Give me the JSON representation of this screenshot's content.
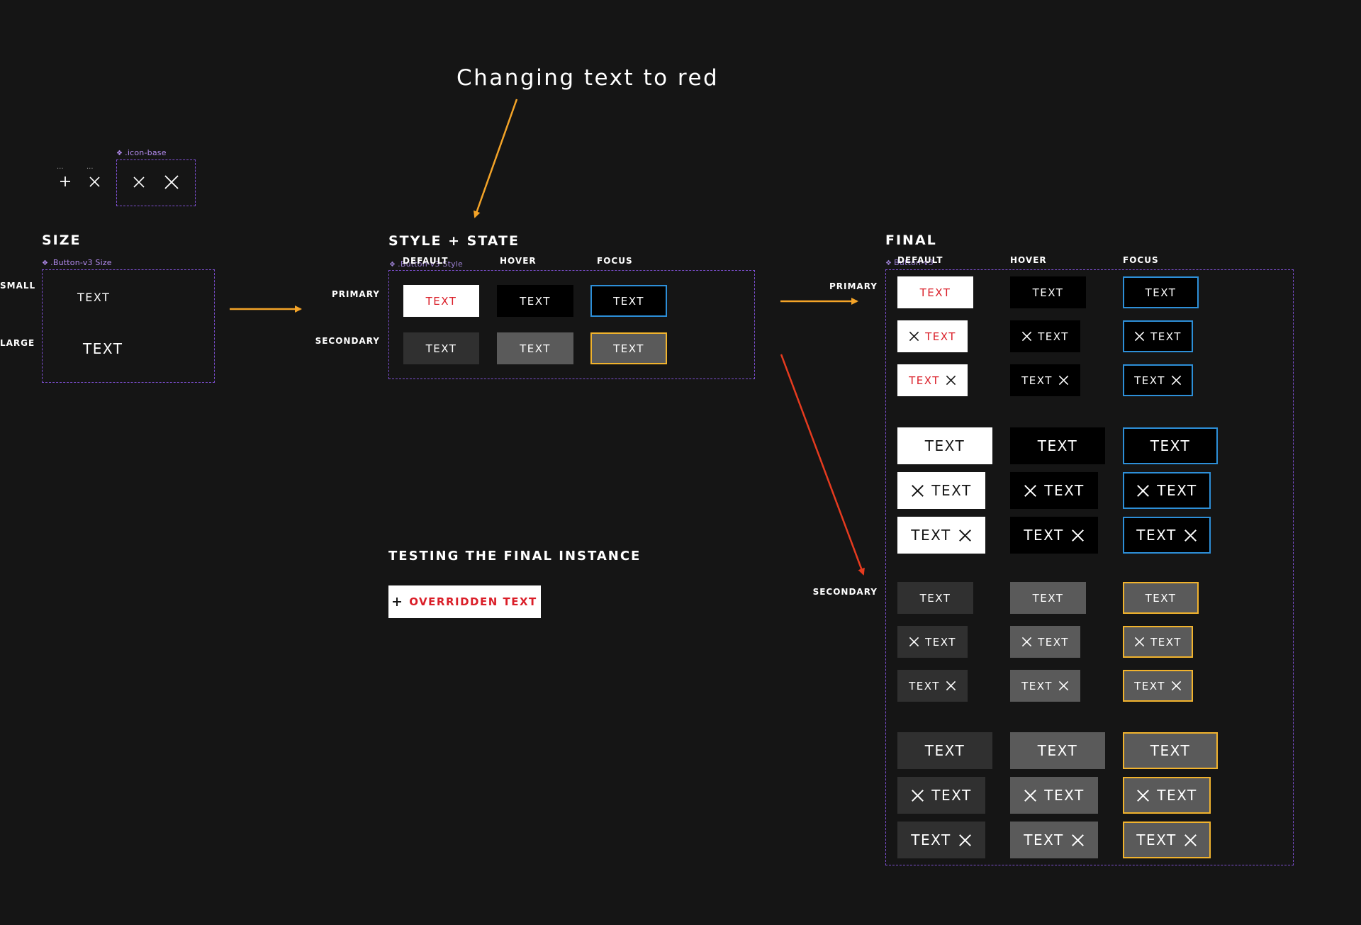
{
  "annotation": {
    "text": "Changing text to red",
    "arrow_color": "#f4a428"
  },
  "icon_base": {
    "label": ".icon-base",
    "loose_icons": [
      "plus-icon",
      "close-icon"
    ],
    "loose_ellipsis": [
      "...",
      "..."
    ],
    "icons": [
      "close-icon",
      "close-icon"
    ]
  },
  "size": {
    "title": "SIZE",
    "component_label": ".Button-v3 Size",
    "rows": [
      {
        "label": "SMALL",
        "text": "TEXT"
      },
      {
        "label": "LARGE",
        "text": "TEXT"
      }
    ]
  },
  "style_state": {
    "title": "STYLE + STATE",
    "component_label": ".Button-v3 Style",
    "columns": [
      "DEFAULT",
      "HOVER",
      "FOCUS"
    ],
    "rows": [
      {
        "label": "PRIMARY",
        "buttons": [
          "TEXT",
          "TEXT",
          "TEXT"
        ]
      },
      {
        "label": "SECONDARY",
        "buttons": [
          "TEXT",
          "TEXT",
          "TEXT"
        ]
      }
    ]
  },
  "final": {
    "title": "FINAL",
    "component_label": "Button-v3",
    "columns": [
      "DEFAULT",
      "HOVER",
      "FOCUS"
    ],
    "row_labels": {
      "primary": "PRIMARY",
      "secondary": "SECONDARY"
    },
    "button_text": "TEXT"
  },
  "testing": {
    "title": "TESTING THE FINAL INSTANCE",
    "button_label": "OVERRIDDEN TEXT",
    "button_icon": "plus-icon"
  },
  "colors": {
    "background": "#151515",
    "component_border": "#7d4fd1",
    "primary_text_red": "#da1e28",
    "focus_blue": "#2d8fd8",
    "focus_yellow": "#f1b32d",
    "arrow_orange": "#f4a428",
    "arrow_red": "#e63b1f",
    "secondary_default": "#303030",
    "secondary_hover": "#5a5a5a"
  }
}
